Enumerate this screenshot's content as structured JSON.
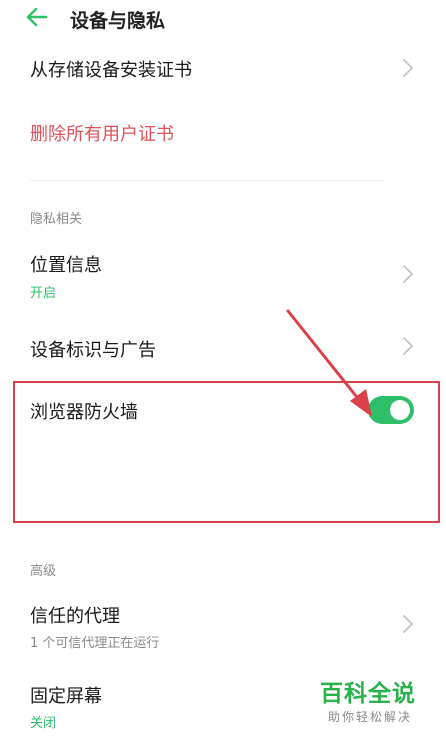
{
  "header": {
    "title": "设备与隐私"
  },
  "items": {
    "install_cert": {
      "label": "从存储设备安装证书"
    },
    "delete_certs": {
      "label": "删除所有用户证书"
    },
    "location": {
      "label": "位置信息",
      "status": "开启"
    },
    "device_id_ads": {
      "label": "设备标识与广告"
    },
    "browser_firewall": {
      "label": "浏览器防火墙",
      "toggle_on": true
    },
    "trust_agents": {
      "label": "信任的代理",
      "subtitle": "1 个可信代理正在运行"
    },
    "screen_pinning": {
      "label": "固定屏幕",
      "status": "关闭"
    }
  },
  "sections": {
    "privacy": "隐私相关",
    "advanced": "高级"
  },
  "watermark": {
    "title": "百科全说",
    "subtitle": "助你轻松解决"
  },
  "colors": {
    "accent_green": "#2fbf6b",
    "danger_red": "#d9414b",
    "watermark_green": "#27b24a"
  }
}
